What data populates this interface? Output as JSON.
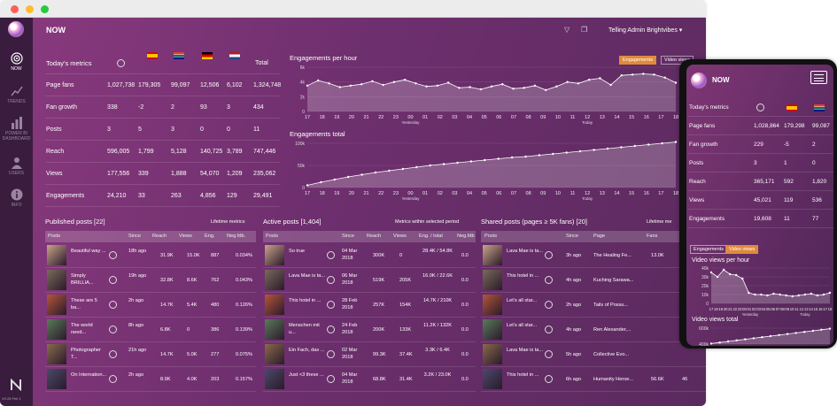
{
  "app": {
    "title": "NOW",
    "admin": "Telling Admin Brightvibes ▾",
    "version": "V0.28 Feb 1"
  },
  "nav": [
    {
      "label": "NOW",
      "icon": "target-icon"
    },
    {
      "label": "TRENDS",
      "icon": "trend-icon"
    },
    {
      "label": "POWER BI DASHBOARD",
      "icon": "bar-chart-icon"
    },
    {
      "label": "USERS",
      "icon": "users-icon"
    },
    {
      "label": "INFO",
      "icon": "info-icon"
    }
  ],
  "metrics": {
    "title": "Today's metrics",
    "total_label": "Total",
    "flags": [
      "globe",
      "es",
      "za",
      "de",
      "nl"
    ],
    "rows": [
      {
        "label": "Page fans",
        "values": [
          "1,027,738",
          "179,305",
          "99,097",
          "12,506",
          "6,102",
          "1,324,748"
        ]
      },
      {
        "label": "Fan growth",
        "values": [
          "338",
          "-2",
          "2",
          "93",
          "3",
          "434"
        ]
      },
      {
        "label": "Posts",
        "values": [
          "3",
          "5",
          "3",
          "0",
          "0",
          "11"
        ]
      },
      {
        "label": "Reach",
        "values": [
          "596,005",
          "1,799",
          "5,128",
          "140,725",
          "3,789",
          "747,446"
        ]
      },
      {
        "label": "Views",
        "values": [
          "177,556",
          "339",
          "1,888",
          "54,070",
          "1,209",
          "235,062"
        ]
      },
      {
        "label": "Engagements",
        "values": [
          "24,210",
          "33",
          "263",
          "4,856",
          "129",
          "29,491"
        ]
      }
    ]
  },
  "chart_toggle": {
    "a": "Engagements",
    "b": "Video views"
  },
  "chart_data": [
    {
      "type": "area",
      "title": "Engagements per hour",
      "x": [
        "17",
        "18",
        "19",
        "20",
        "21",
        "22",
        "23",
        "00",
        "01",
        "02",
        "03",
        "04",
        "05",
        "06",
        "07",
        "08",
        "09",
        "10",
        "11",
        "12",
        "13",
        "14",
        "15",
        "16",
        "17",
        "18"
      ],
      "xsub": {
        "Yesterday": "00",
        "Today": "12"
      },
      "y": [
        3.5,
        4.2,
        3.8,
        3.3,
        3.5,
        3.7,
        4.1,
        3.6,
        4.0,
        4.3,
        3.8,
        3.4,
        3.5,
        3.9,
        3.2,
        3.3,
        3.0,
        3.4,
        3.7,
        3.1,
        3.2,
        3.5,
        2.9,
        3.4,
        4.0,
        3.8,
        4.3,
        4.5,
        3.6,
        4.9,
        5.0,
        5.1,
        5.0,
        4.6,
        3.9
      ],
      "yticks": [
        "0",
        "2k",
        "4k",
        "6k"
      ],
      "ylim": [
        0,
        6
      ]
    },
    {
      "type": "area",
      "title": "Engagements total",
      "x": [
        "17",
        "18",
        "19",
        "20",
        "21",
        "22",
        "23",
        "00",
        "01",
        "02",
        "03",
        "04",
        "05",
        "06",
        "07",
        "08",
        "09",
        "10",
        "11",
        "12",
        "13",
        "14",
        "15",
        "16",
        "17",
        "18"
      ],
      "xsub": {
        "Yesterday": "00",
        "Today": "12"
      },
      "y": [
        5,
        12,
        18,
        24,
        29,
        34,
        38,
        42,
        46,
        50,
        53,
        56,
        59,
        62,
        65,
        68,
        70,
        73,
        76,
        79,
        82,
        85,
        88,
        91,
        94,
        97,
        100,
        103
      ],
      "yticks": [
        "0",
        "50k",
        "100k"
      ],
      "ylim": [
        0,
        100
      ]
    }
  ],
  "published": {
    "title": "Published posts [22]",
    "note": "Lifetime metrics",
    "cols": [
      "Posts",
      "Since",
      "Reach",
      "Views",
      "Eng.",
      "Neg.fdb."
    ],
    "rows": [
      {
        "post": "Beautiful way ...",
        "since": "18h ago",
        "reach": "31.9K",
        "views": "15.0K",
        "eng": "887",
        "neg": "0.034%"
      },
      {
        "post": "Simply BRILLIA...",
        "since": "19h ago",
        "reach": "32.8K",
        "views": "8.6K",
        "eng": "762",
        "neg": "0.043%"
      },
      {
        "post": "These are 5 ba...",
        "since": "2h ago",
        "reach": "14.7K",
        "views": "5.4K",
        "eng": "480",
        "neg": "0.126%"
      },
      {
        "post": "The world need...",
        "since": "8h ago",
        "reach": "6.8K",
        "views": "0",
        "eng": "386",
        "neg": "0.139%"
      },
      {
        "post": "Photographer T...",
        "since": "21h ago",
        "reach": "14.7K",
        "views": "5.0K",
        "eng": "277",
        "neg": "0.075%"
      },
      {
        "post": "On Internation...",
        "since": "2h ago",
        "reach": "8.9K",
        "views": "4.0K",
        "eng": "203",
        "neg": "0.157%"
      }
    ]
  },
  "active": {
    "title": "Active posts [1,404]",
    "note": "Metrics within selected period",
    "cols": [
      "Posts",
      "Since",
      "Reach",
      "Views",
      "Eng. / total",
      "Neg.fdb"
    ],
    "rows": [
      {
        "post": "So true",
        "since": "04 Mar 2018",
        "reach": "300K",
        "views": "0",
        "eng": "28.4K / 54.8K",
        "neg": "0.0"
      },
      {
        "post": "Lava Mae is ta...",
        "since": "06 Mar 2018",
        "reach": "519K",
        "views": "205K",
        "eng": "16.0K / 22.6K",
        "neg": "0.0"
      },
      {
        "post": "This hotel in ...",
        "since": "28 Feb 2018",
        "reach": "257K",
        "views": "154K",
        "eng": "14.7K / 210K",
        "neg": "0.0"
      },
      {
        "post": "Menschen mit u...",
        "since": "24 Feb 2018",
        "reach": "200K",
        "views": "133K",
        "eng": "11.2K / 132K",
        "neg": "0.0"
      },
      {
        "post": "Ein Fach, das ...",
        "since": "02 Mar 2018",
        "reach": "99.3K",
        "views": "37.4K",
        "eng": "3.3K / 6.4K",
        "neg": "0.0"
      },
      {
        "post": "Just <3 these ...",
        "since": "04 Mar 2018",
        "reach": "68.8K",
        "views": "31.4K",
        "eng": "3.2K / 23.0K",
        "neg": "0.0"
      }
    ]
  },
  "shared": {
    "title": "Shared posts (pages ≥ 5K fans) [20]",
    "note": "Lifetime me",
    "cols": [
      "Posts",
      "Since",
      "Page",
      "Fans",
      ""
    ],
    "rows": [
      {
        "post": "Lava Mae is ta...",
        "since": "3h ago",
        "page": "The Healing Fe...",
        "fans": "13.0K"
      },
      {
        "post": "This hotel in ...",
        "since": "4h ago",
        "page": "Kuching Sarawa...",
        "fans": ""
      },
      {
        "post": "Let's all star...",
        "since": "2h ago",
        "page": "Tails of Possu...",
        "fans": ""
      },
      {
        "post": "Let's all star...",
        "since": "4h ago",
        "page": "Ren Alexander,...",
        "fans": ""
      },
      {
        "post": "Lava Mae is ta...",
        "since": "5h ago",
        "page": "Collective Evo...",
        "fans": ""
      },
      {
        "post": "This hotel in ...",
        "since": "6h ago",
        "page": "Humanity Heroe...",
        "fans": "56.6K",
        "extra": "46"
      }
    ]
  },
  "phone": {
    "title": "NOW",
    "metrics_title": "Today's metrics",
    "rows": [
      {
        "label": "Page fans",
        "values": [
          "1,028,864",
          "179,298",
          "99,087"
        ]
      },
      {
        "label": "Fan growth",
        "values": [
          "229",
          "-5",
          "2"
        ]
      },
      {
        "label": "Posts",
        "values": [
          "3",
          "1",
          "0"
        ]
      },
      {
        "label": "Reach",
        "values": [
          "365,171",
          "592",
          "1,820"
        ]
      },
      {
        "label": "Views",
        "values": [
          "45,021",
          "119",
          "536"
        ]
      },
      {
        "label": "Engagements",
        "values": [
          "19,608",
          "11",
          "77"
        ]
      }
    ],
    "toggle_a": "Engagements",
    "toggle_b": "Video views",
    "chart1_title": "Video views per hour",
    "chart1_yticks": [
      "0",
      "10k",
      "20k",
      "30k",
      "40k"
    ],
    "chart1_y": [
      35,
      30,
      38,
      33,
      32,
      28,
      12,
      10,
      10,
      9,
      11,
      10,
      9,
      8,
      9,
      10,
      11,
      9,
      10,
      12
    ],
    "chart1_x": [
      "17",
      "18",
      "19",
      "20",
      "21",
      "22",
      "23",
      "00",
      "01",
      "02",
      "03",
      "04",
      "05",
      "06",
      "07",
      "08",
      "09",
      "10",
      "11",
      "12",
      "13",
      "14",
      "15",
      "16",
      "17",
      "18"
    ],
    "chart1_sub": {
      "Yesterday": "Yesterday",
      "Today": "Today"
    },
    "chart1_ylim": [
      0,
      40
    ],
    "chart2_title": "Video views total",
    "chart2_yticks": [
      "400k",
      "600k"
    ],
    "chart2_y": [
      1,
      3,
      5,
      7,
      9,
      11,
      13,
      15,
      17,
      19,
      21,
      23,
      25,
      27,
      29
    ],
    "chart2_ylim": [
      0,
      30
    ]
  }
}
